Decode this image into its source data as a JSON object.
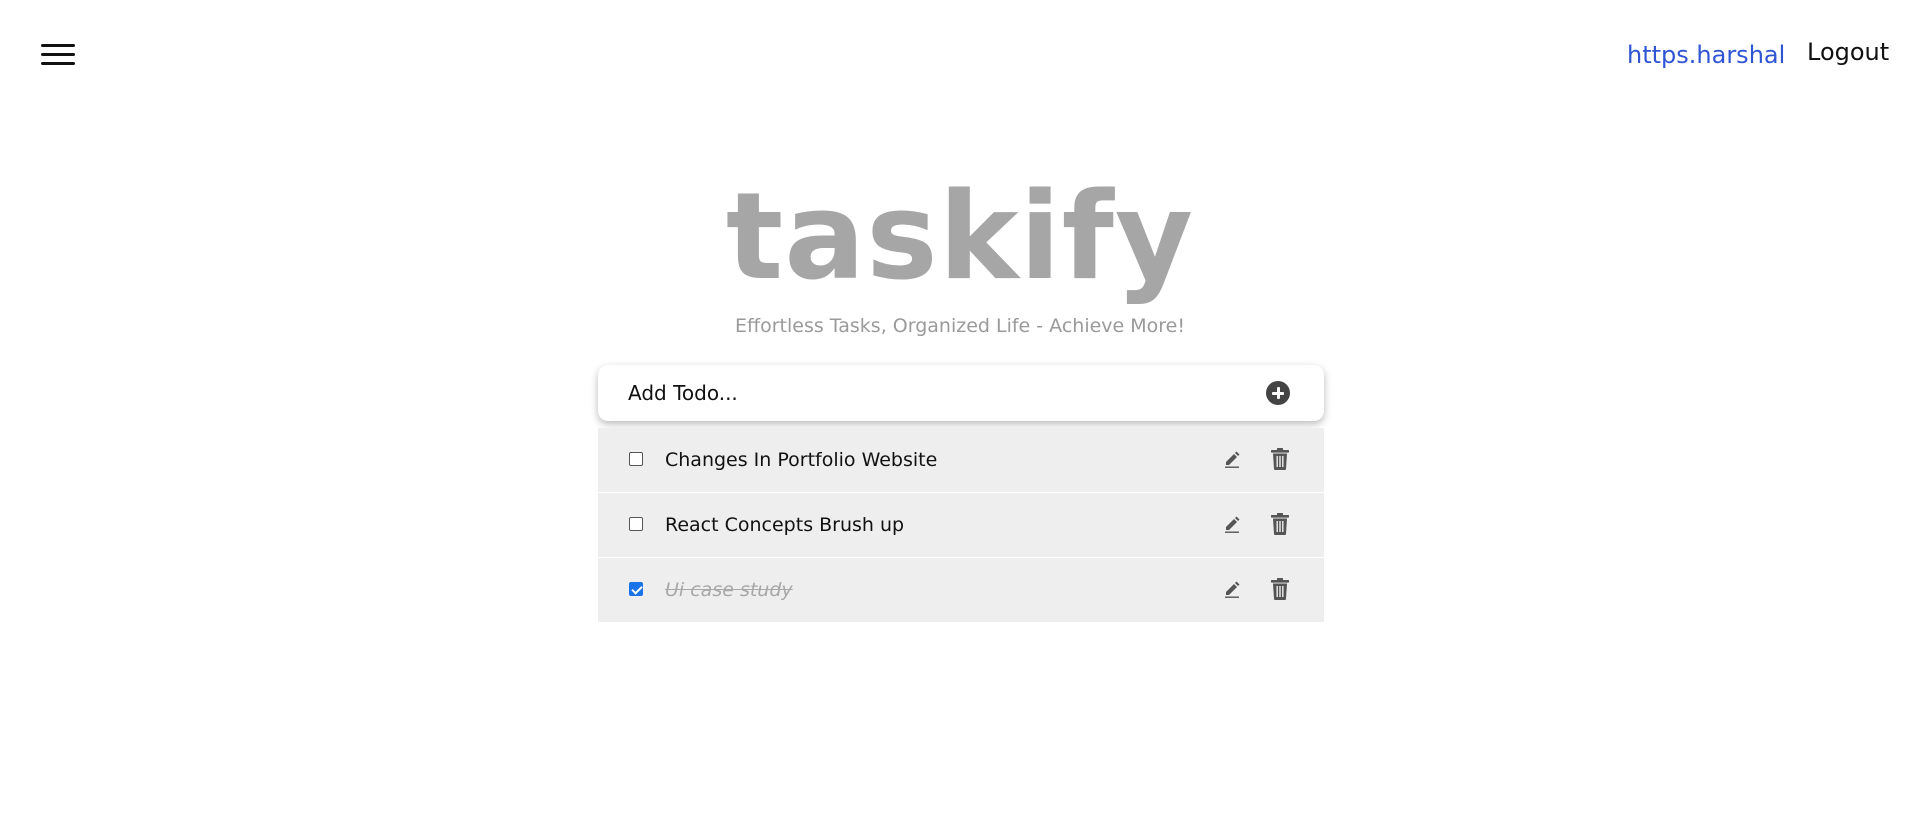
{
  "header": {
    "menu_icon": "hamburger-menu-icon",
    "user_link": "https.harshal",
    "logout_label": "Logout",
    "accent_color": "#2f55d4"
  },
  "brand": {
    "title": "taskify",
    "tagline": "Effortless Tasks, Organized Life - Achieve More!"
  },
  "add_todo": {
    "placeholder": "Add Todo...",
    "add_icon": "plus-circle-icon"
  },
  "todos": [
    {
      "text": "Changes In Portfolio Website",
      "done": false
    },
    {
      "text": "React Concepts Brush up",
      "done": false
    },
    {
      "text": "Ui case study",
      "done": true
    }
  ],
  "row_icons": {
    "edit": "pencil-icon",
    "delete": "trash-icon"
  }
}
